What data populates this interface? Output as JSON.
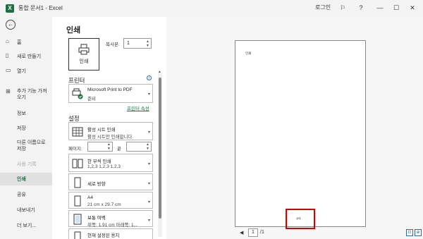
{
  "app": {
    "logo_letter": "X",
    "title": "통합 문서1  -  Excel",
    "login": "로그인",
    "accent_color": "#1d6f42"
  },
  "sidebar": {
    "items": [
      {
        "label": "홈",
        "icon": "home-icon"
      },
      {
        "label": "새로 만들기",
        "icon": "new-file-icon"
      },
      {
        "label": "열기",
        "icon": "folder-open-icon"
      },
      {
        "label": "추가 기능 가져오기",
        "line1": "추가 기능 가져",
        "line2": "오기",
        "icon": "add-in-grid-icon"
      },
      {
        "label": "정보"
      },
      {
        "label": "저장"
      },
      {
        "label": "다른 이름으로 저장",
        "line1": "다른 이름으로",
        "line2": "저장"
      },
      {
        "label": "사용 기록"
      },
      {
        "label": "인쇄"
      },
      {
        "label": "공유"
      },
      {
        "label": "내보내기"
      },
      {
        "label": "더 보기..."
      }
    ]
  },
  "print": {
    "title": "인쇄",
    "print_button": "인쇄",
    "copies_label": "복사본:",
    "copies_value": "1",
    "printer_heading": "프린터",
    "printer_name": "Microsoft Print to PDF",
    "printer_status": "준비",
    "printer_properties": "프린터 속성",
    "settings_heading": "설정",
    "settings": [
      {
        "line1": "활성 시트 인쇄",
        "line2": "활성 시트만 인쇄합니다."
      },
      {
        "line1": "한 부씩 인쇄",
        "line2": "1,2,3     1,2,3     1,2,3"
      },
      {
        "line1": "세로 방향",
        "line2": ""
      },
      {
        "line1": "A4",
        "line2": "21 cm x 29.7 cm"
      },
      {
        "line1": "보통 여백",
        "line2": "위쪽: 1.91 cm 아래쪽: 1..."
      },
      {
        "line1": "현재 설정된 용지",
        "line2": ""
      }
    ],
    "pages_label": "페이지:",
    "pages_to": "끝"
  },
  "preview": {
    "header_text": "인쇄",
    "footer_text": "상태",
    "current_page": "1",
    "total_pages": "/1"
  }
}
